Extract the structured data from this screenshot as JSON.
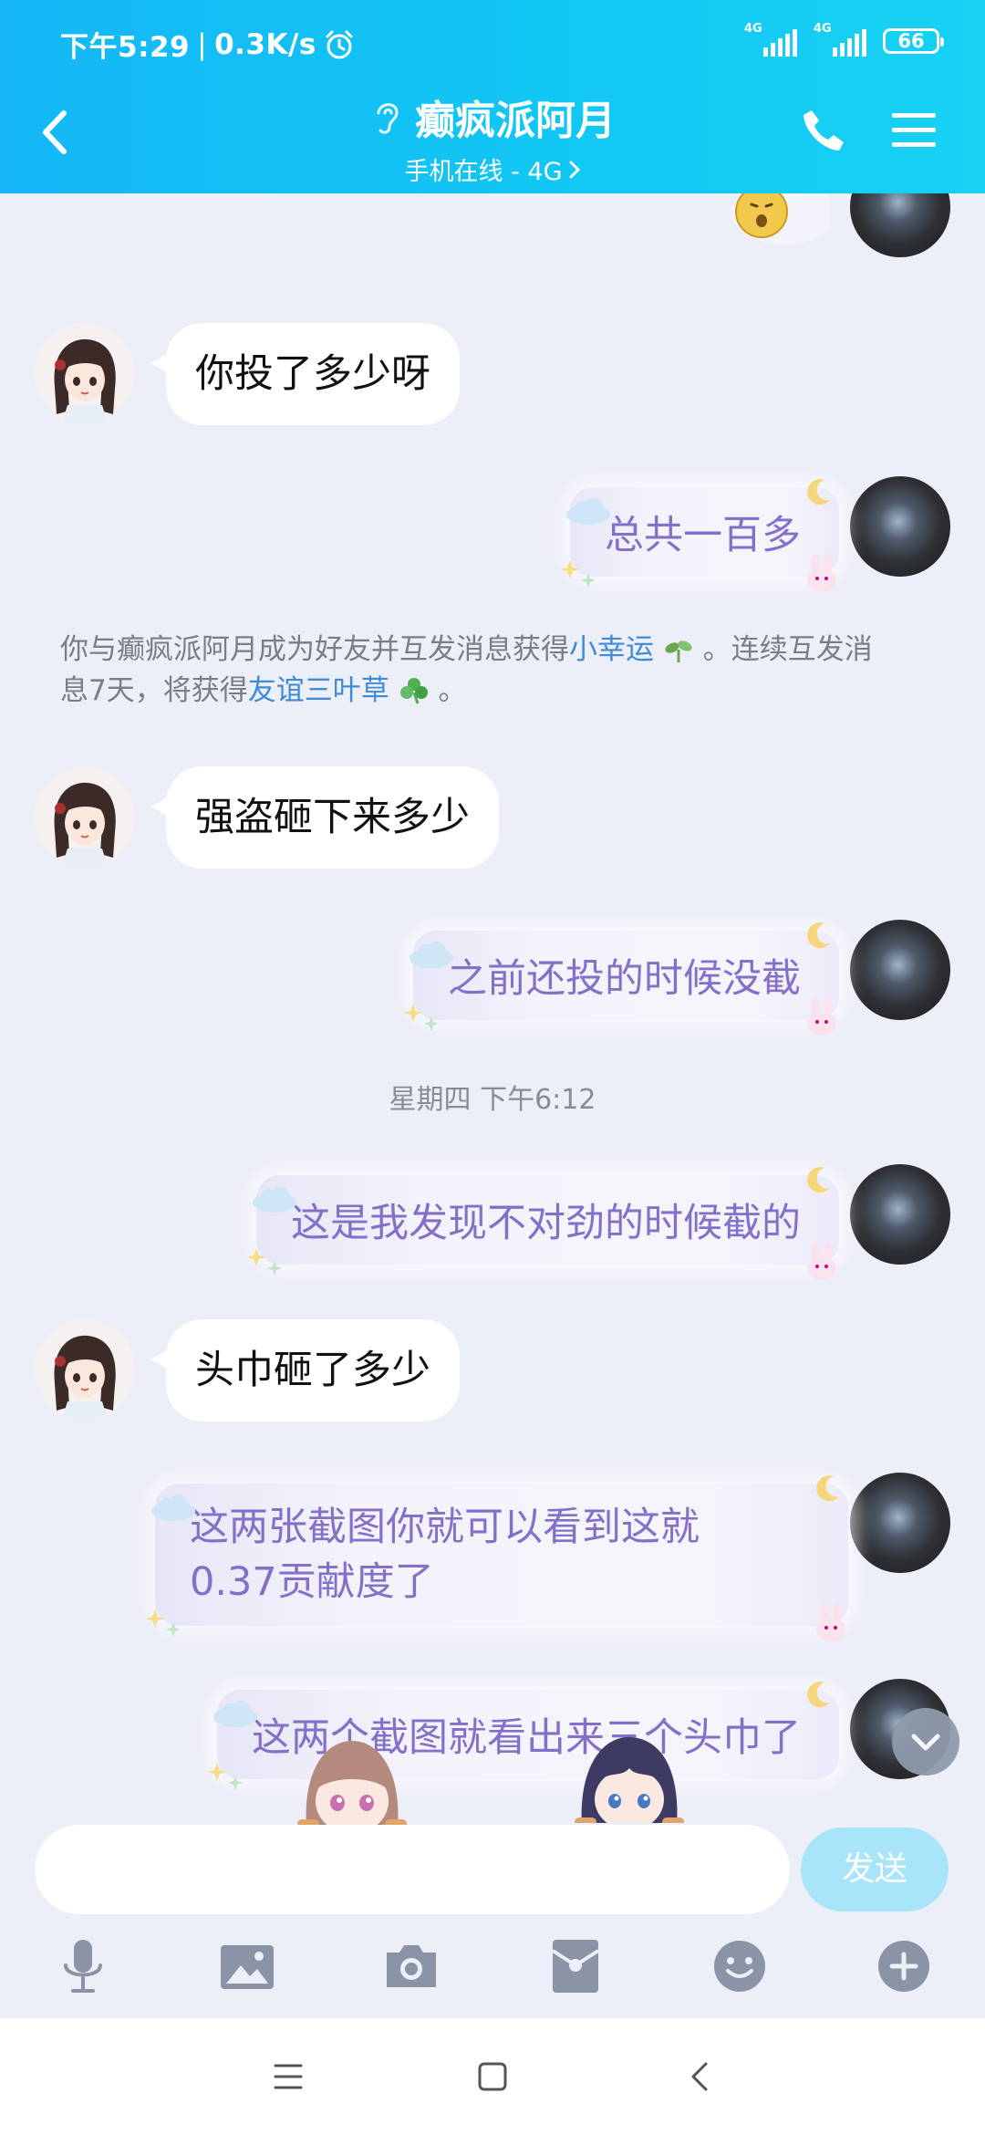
{
  "status_bar": {
    "time": "下午5:29",
    "speed": "0.3K/s",
    "network_tag_1": "4G",
    "network_tag_2": "4G",
    "battery": "66"
  },
  "header": {
    "title": "癫疯派阿月",
    "subtitle": "手机在线 - 4G"
  },
  "messages": [
    {
      "from": "friend",
      "text": "你投了多少呀"
    },
    {
      "from": "me",
      "text": "总共一百多"
    },
    {
      "from": "friend",
      "text": "强盗砸下来多少"
    },
    {
      "from": "me",
      "text": "之前还投的时候没截"
    },
    {
      "from": "me",
      "text": "这是我发现不对劲的时候截的"
    },
    {
      "from": "friend",
      "text": "头巾砸了多少"
    },
    {
      "from": "me",
      "text": "这两张截图你就可以看到这就",
      "text_line2": "0.37贡献度了"
    },
    {
      "from": "me",
      "text": "这两个截图就看出来三个头巾了"
    }
  ],
  "system_message": {
    "part1": "你与癫疯派阿月成为好友并互发消息获得",
    "link1": "小幸运",
    "part2": "。连续互发消",
    "part3": "息7天，将获得",
    "link2": "友谊三叶草",
    "part4": "。"
  },
  "timestamp": "星期四 下午6:12",
  "input": {
    "value": "",
    "send_label": "发送"
  },
  "toolbar_icons": [
    "microphone-icon",
    "image-icon",
    "camera-icon",
    "red-packet-icon",
    "emoji-icon",
    "plus-icon"
  ],
  "colors": {
    "header": "#15b7f6",
    "outgoing_text": "#8470c8",
    "link": "#3f8ad9",
    "send_button": "#a9e5f8"
  }
}
